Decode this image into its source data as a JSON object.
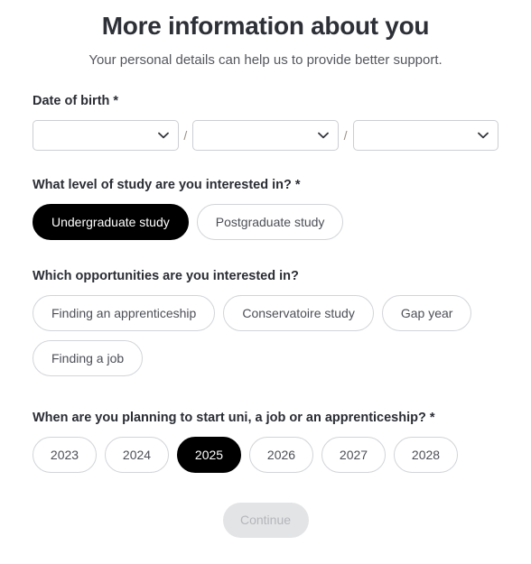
{
  "header": {
    "title": "More information about you",
    "subtitle": "Your personal details can help us to provide better support."
  },
  "fields": {
    "date_of_birth": {
      "label": "Date of birth *",
      "separator": "/",
      "selects": [
        {
          "name": "day",
          "value": "",
          "placeholder": ""
        },
        {
          "name": "month",
          "value": "",
          "placeholder": ""
        },
        {
          "name": "year",
          "value": "",
          "placeholder": ""
        }
      ],
      "chevron_icon": "chevron-down-icon"
    },
    "study_level": {
      "label": "What level of study are you interested in? *",
      "options": [
        {
          "label": "Undergraduate study",
          "selected": true
        },
        {
          "label": "Postgraduate study",
          "selected": false
        }
      ]
    },
    "opportunities": {
      "label": "Which opportunities are you interested in?",
      "options": [
        {
          "label": "Finding an apprenticeship",
          "selected": false
        },
        {
          "label": "Conservatoire study",
          "selected": false
        },
        {
          "label": "Gap year",
          "selected": false
        },
        {
          "label": "Finding a job",
          "selected": false
        }
      ]
    },
    "start_year": {
      "label": "When are you planning to start uni, a job or an apprenticeship? *",
      "options": [
        {
          "label": "2023",
          "selected": false
        },
        {
          "label": "2024",
          "selected": false
        },
        {
          "label": "2025",
          "selected": true
        },
        {
          "label": "2026",
          "selected": false
        },
        {
          "label": "2027",
          "selected": false
        },
        {
          "label": "2028",
          "selected": false
        }
      ]
    }
  },
  "footer": {
    "continue_label": "Continue",
    "continue_disabled": true
  },
  "colors": {
    "selected_pill_bg": "#000000",
    "selected_pill_text": "#ffffff",
    "pill_border": "#d2d4d8",
    "pill_text": "#4d4f57",
    "title_text": "#2e3038",
    "subtitle_text": "#55575e",
    "disabled_button_bg": "#e3e4e6",
    "disabled_button_text": "#b4b6ba",
    "select_border": "#ccced3",
    "page_bg": "#ffffff"
  }
}
